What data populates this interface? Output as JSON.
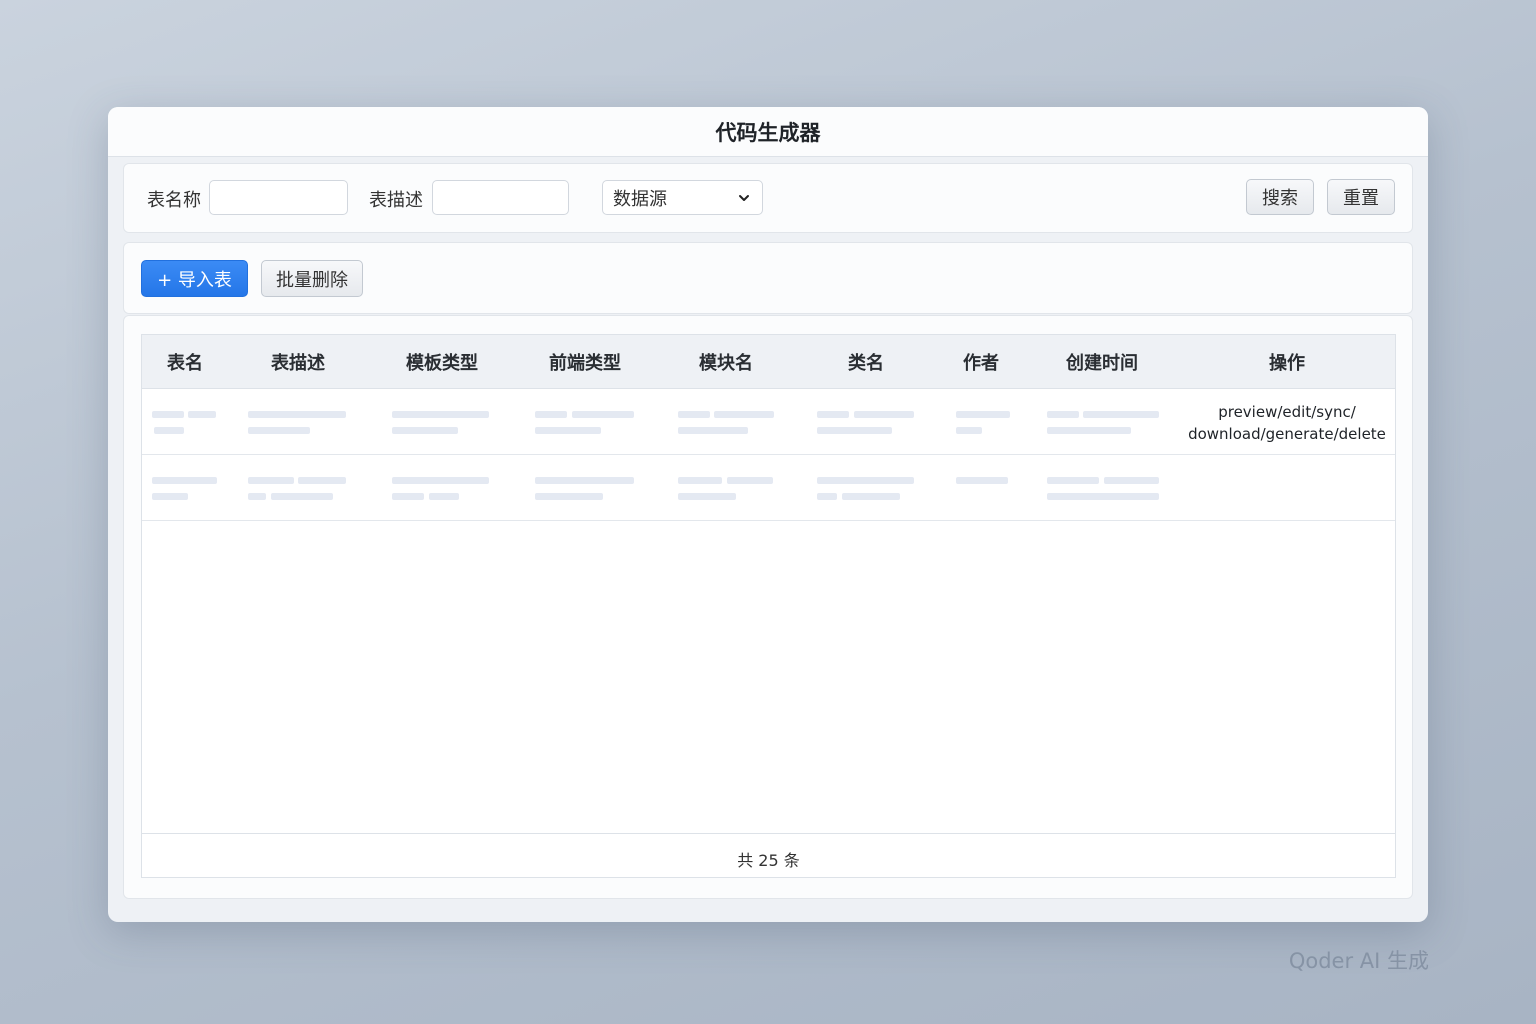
{
  "window": {
    "title": "代码生成器"
  },
  "search": {
    "table_name_label": "表名称",
    "table_name_value": "",
    "table_desc_label": "表描述",
    "table_desc_value": "",
    "datasource_selected": "数据源",
    "search_label": "搜索",
    "reset_label": "重置"
  },
  "actions": {
    "import_label": "+ 导入表",
    "batch_delete_label": "批量删除",
    "primary_color": "#2476e8"
  },
  "table": {
    "columns": [
      "表名",
      "表描述",
      "模板类型",
      "前端类型",
      "模块名",
      "类名",
      "作者",
      "创建时间",
      "操作"
    ],
    "operations_line1": "preview/edit/sync/",
    "operations_line2": "download/generate/delete",
    "total_text": "共 25 条"
  },
  "watermark": "Qoder AI 生成"
}
